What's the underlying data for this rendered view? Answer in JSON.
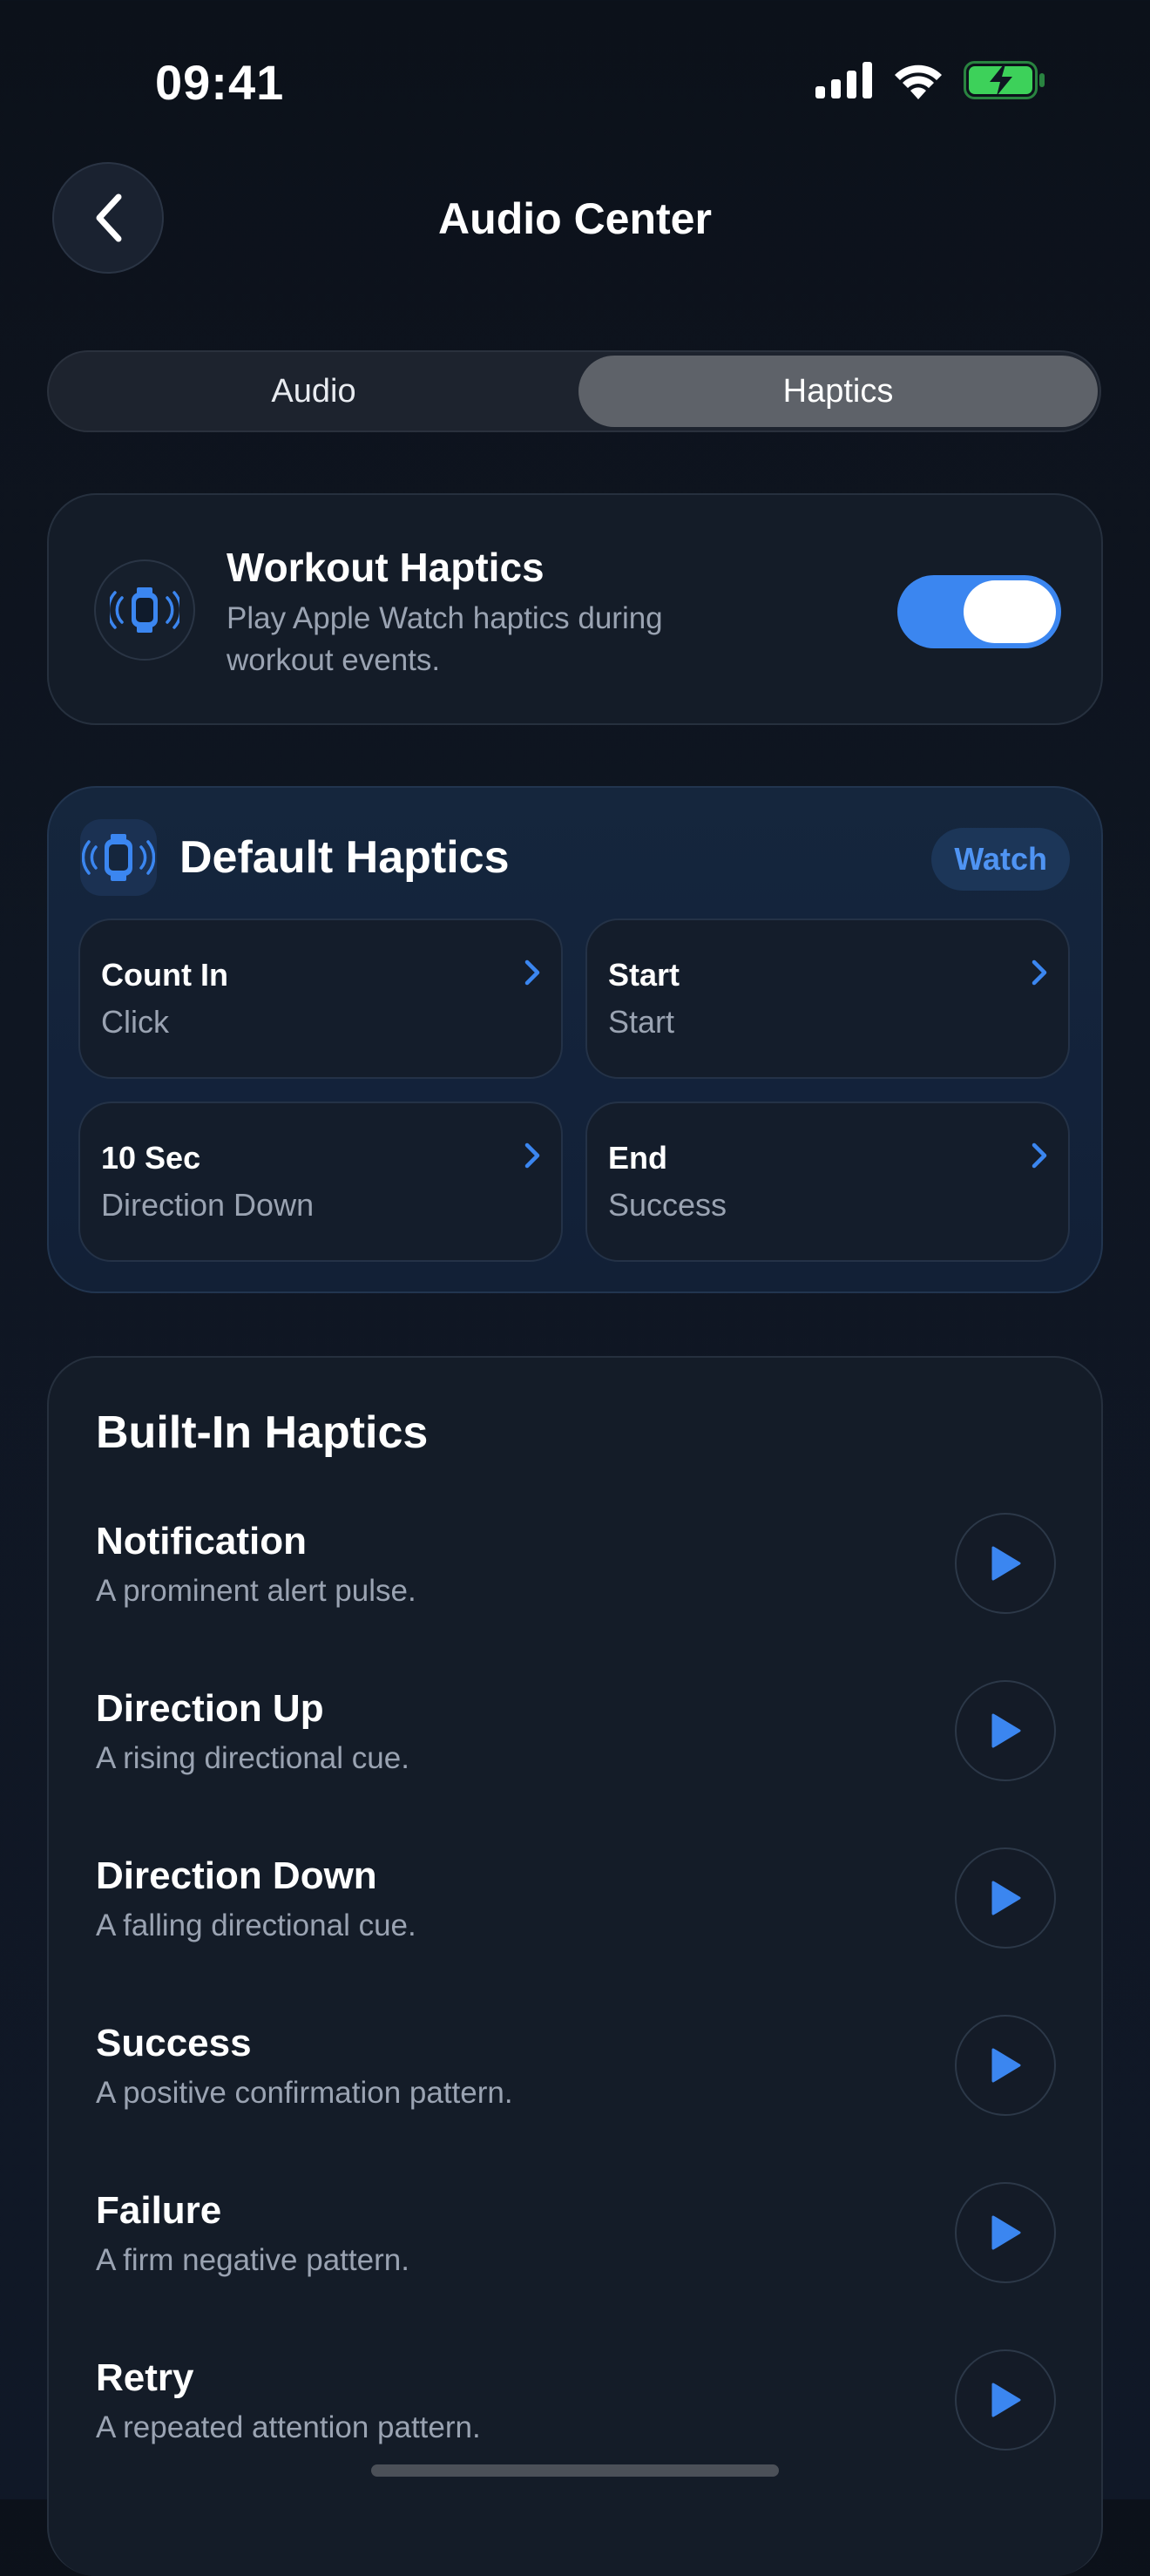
{
  "status_bar": {
    "time": "09:41",
    "battery_color": "#3dd15a"
  },
  "nav": {
    "title": "Audio Center",
    "back_icon": "chevron-left-icon"
  },
  "segmented_control": {
    "items": [
      {
        "label": "Audio",
        "selected": false
      },
      {
        "label": "Haptics",
        "selected": true
      }
    ]
  },
  "workout_haptics": {
    "icon": "watch-haptic-icon",
    "title": "Workout Haptics",
    "description": "Play Apple Watch haptics during workout events.",
    "enabled": true
  },
  "default_haptics": {
    "icon": "watch-haptic-icon",
    "title": "Default Haptics",
    "badge": "Watch",
    "tiles": [
      {
        "title": "Count In",
        "value": "Click"
      },
      {
        "title": "Start",
        "value": "Start"
      },
      {
        "title": "10 Sec",
        "value": "Direction Down"
      },
      {
        "title": "End",
        "value": "Success"
      }
    ]
  },
  "built_in_haptics": {
    "title": "Built-In Haptics",
    "items": [
      {
        "title": "Notification",
        "description": "A prominent alert pulse."
      },
      {
        "title": "Direction Up",
        "description": "A rising directional cue."
      },
      {
        "title": "Direction Down",
        "description": "A falling directional cue."
      },
      {
        "title": "Success",
        "description": "A positive confirmation pattern."
      },
      {
        "title": "Failure",
        "description": "A firm negative pattern."
      },
      {
        "title": "Retry",
        "description": "A repeated attention pattern."
      }
    ]
  },
  "colors": {
    "accent": "#3b86f0",
    "secondary_text": "#9aa3b2"
  }
}
